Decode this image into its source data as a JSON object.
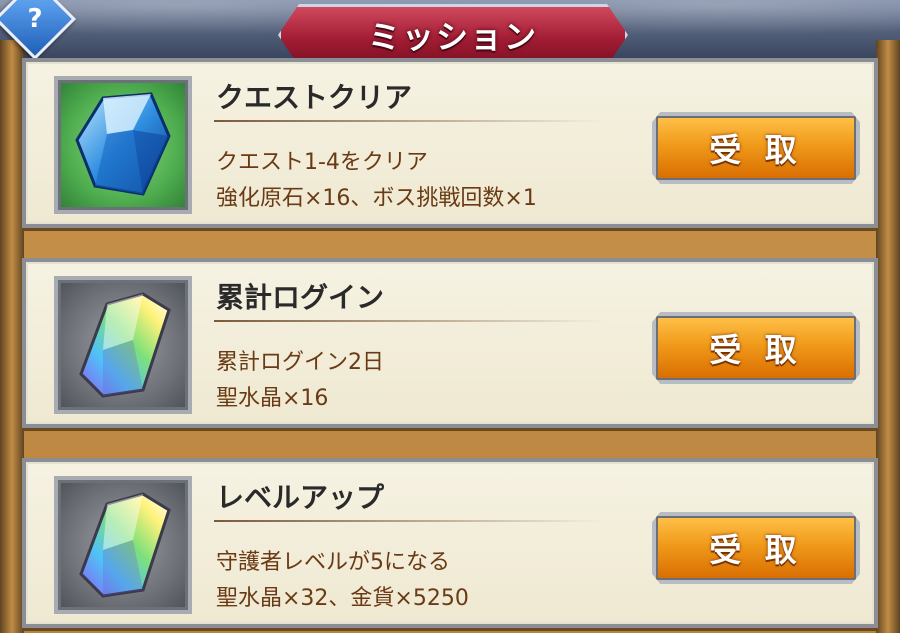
{
  "header": {
    "title": "ミッション",
    "help_label": "?"
  },
  "missions": [
    {
      "title": "クエストクリア",
      "description": "クエスト1-4をクリア",
      "reward": "強化原石×16、ボス挑戦回数×1",
      "icon": "blue-crystal-icon",
      "frame_color": "#4fae4f",
      "button_label": "受 取"
    },
    {
      "title": "累計ログイン",
      "description": "累計ログイン2日",
      "reward": "聖水晶×16",
      "icon": "rainbow-crystal-icon",
      "frame_color": "#6f7278",
      "button_label": "受 取"
    },
    {
      "title": "レベルアップ",
      "description": "守護者レベルが5になる",
      "reward": "聖水晶×32、金貨×5250",
      "icon": "rainbow-crystal-icon",
      "frame_color": "#6f7278",
      "button_label": "受 取"
    }
  ],
  "colors": {
    "title_banner": "#a41e35",
    "button": "#f09a1a",
    "card_bg": "#f6f2e2",
    "description_text": "#6a3a14"
  }
}
